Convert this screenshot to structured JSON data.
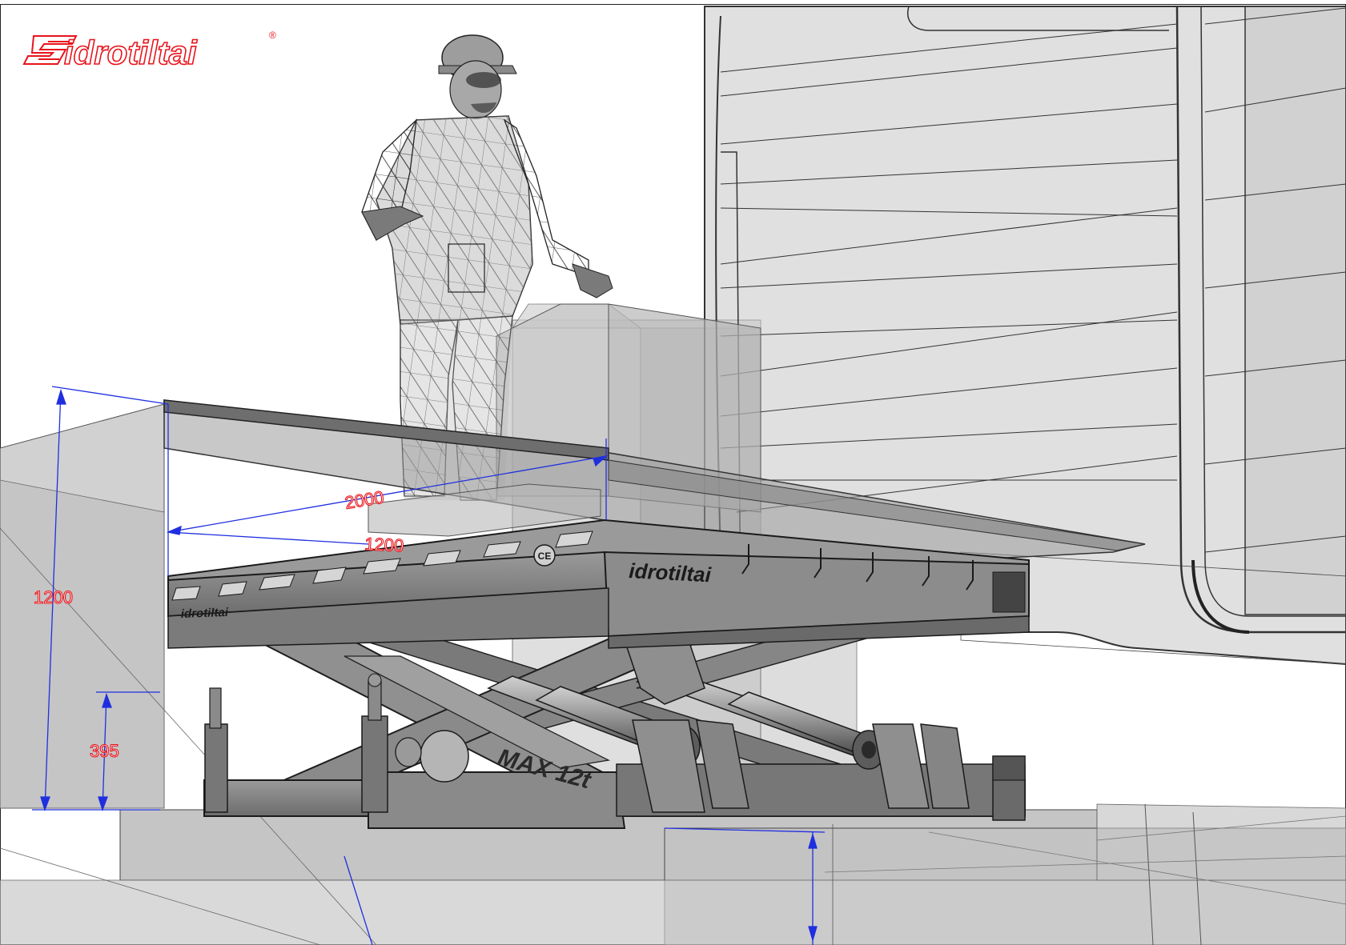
{
  "logo": {
    "text": "idrotiltai",
    "registered": "®",
    "color": "#e8141c"
  },
  "platform_brand": "idrotiltai",
  "platform_brand_small": "idrotiltai",
  "lift_capacity_label": "MAX 12t",
  "ce_mark": "CE",
  "dimensions": {
    "height_total": "1200",
    "height_closed": "395",
    "platform_length": "2000",
    "platform_width": "1200"
  },
  "colors": {
    "dimension_line": "#1f2fe0",
    "dimension_text": "#e8141c",
    "steel": "#8a8a8a",
    "steel_dark": "#3a3a3a",
    "ghost_fill": "#bdbdbd"
  }
}
